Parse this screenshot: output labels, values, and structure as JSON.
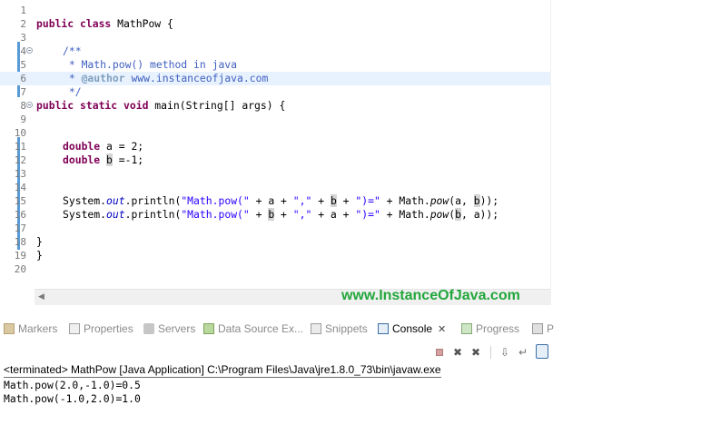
{
  "editor": {
    "lines": [
      {
        "n": "1"
      },
      {
        "n": "2"
      },
      {
        "n": "3"
      },
      {
        "n": "4"
      },
      {
        "n": "5"
      },
      {
        "n": "6"
      },
      {
        "n": "7"
      },
      {
        "n": "8"
      },
      {
        "n": "9"
      },
      {
        "n": "10"
      },
      {
        "n": "11"
      },
      {
        "n": "12"
      },
      {
        "n": "13"
      },
      {
        "n": "14"
      },
      {
        "n": "15"
      },
      {
        "n": "16"
      },
      {
        "n": "17"
      },
      {
        "n": "18"
      },
      {
        "n": "19"
      },
      {
        "n": "20"
      }
    ],
    "code": {
      "l2_kw": "public class",
      "l2_rest": " MathPow {",
      "l4": "/**",
      "l5": " * Math.pow() method in java",
      "l6_star": " * ",
      "l6_tag": "@author",
      "l6_rest": " www.instanceofjava.com",
      "l7": " */",
      "l8_kw": "public static void",
      "l8_rest": " main(String[] args) {",
      "l11_kw": "double",
      "l11_rest": " a = 2;",
      "l12_kw": "double",
      "l12_sp": " ",
      "l12_b": "b",
      "l12_rest": " =-1;",
      "l15_a": "System.",
      "l15_out": "out",
      "l15_b": ".println(",
      "l15_s1": "\"Math.pow(\"",
      "l15_c": " + a + ",
      "l15_s2": "\",\"",
      "l15_d": " + ",
      "l15_bb": "b",
      "l15_e": " + ",
      "l15_s3": "\")=\"",
      "l15_f": " + Math.",
      "l15_pow": "pow",
      "l15_g": "(a, ",
      "l15_bb2": "b",
      "l15_h": "));",
      "l16_a": "System.",
      "l16_out": "out",
      "l16_b": ".println(",
      "l16_s1": "\"Math.pow(\"",
      "l16_c": " + ",
      "l16_bb": "b",
      "l16_d": " + ",
      "l16_s2": "\",\"",
      "l16_e": " + a + ",
      "l16_s3": "\")=\"",
      "l16_f": " + Math.",
      "l16_pow": "pow",
      "l16_g": "(",
      "l16_bb2": "b",
      "l16_h": ", a));",
      "l18": "}",
      "l19": "}"
    }
  },
  "watermark": "www.InstanceOfJava.com",
  "tabs": [
    {
      "label": "Markers",
      "icon": "markers-icon"
    },
    {
      "label": "Properties",
      "icon": "properties-icon"
    },
    {
      "label": "Servers",
      "icon": "servers-icon"
    },
    {
      "label": "Data Source Ex...",
      "icon": "data-source-explorer-icon"
    },
    {
      "label": "Snippets",
      "icon": "snippets-icon"
    },
    {
      "label": "Console",
      "icon": "console-icon",
      "close": "✕"
    },
    {
      "label": "Progress",
      "icon": "progress-icon"
    },
    {
      "label": "P",
      "icon": "problems-icon"
    }
  ],
  "toolbar": {
    "remove_glyph": "✖",
    "remove_all_glyph": "✖",
    "scroll_lock_glyph": "⇩",
    "word_wrap_glyph": "↵"
  },
  "console": {
    "header": "<terminated> MathPow [Java Application] C:\\Program Files\\Java\\jre1.8.0_73\\bin\\javaw.exe",
    "output": [
      "Math.pow(2.0,-1.0)=0.5",
      "Math.pow(-1.0,2.0)=1.0"
    ]
  },
  "colors": {
    "keyword": "#7f0055",
    "comment": "#3f5fbf",
    "string": "#2a00ff",
    "field": "#0000c0",
    "watermark": "#22a63b",
    "current_line": "#e8f2fe"
  }
}
